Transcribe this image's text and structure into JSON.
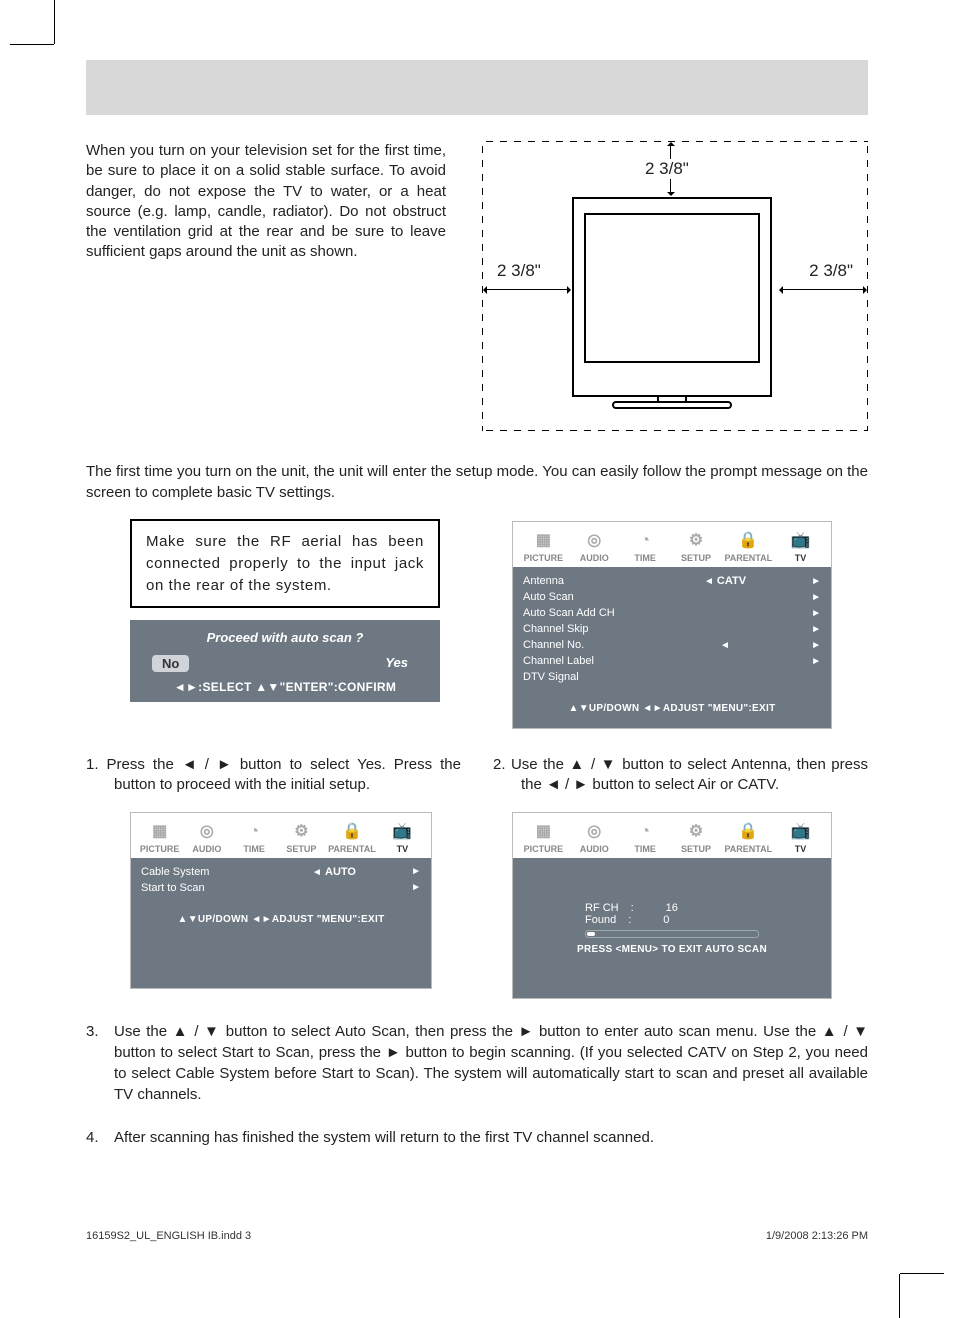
{
  "intro": "When you turn on your television set for the first time, be sure to place it on a solid stable surface. To avoid danger, do not expose the TV to water, or a heat source (e.g. lamp, candle, radiator). Do not obstruct the ventilation grid at the rear and be sure to leave sufficient gaps around the unit as shown.",
  "dims": {
    "top": "2  3/8\"",
    "left": "2  3/8\"",
    "right": "2  3/8\""
  },
  "setup_intro": "The first time you turn on the unit, the unit will enter the setup mode. You can easily follow the prompt message on the screen to complete basic TV settings.",
  "aerial_box": "Make sure the RF aerial has been connected properly to the                      input jack on the rear of the system.",
  "autoscan": {
    "question": "Proceed with auto scan ?",
    "no": "No",
    "yes": "Yes",
    "hint": "◄►:SELECT   ▲▼\"ENTER\":CONFIRM"
  },
  "osd_tabs": [
    "PICTURE",
    "AUDIO",
    "TIME",
    "SETUP",
    "PARENTAL",
    "TV"
  ],
  "osd_icons": [
    "▦",
    "◎",
    "◔",
    "⚙",
    "🔒",
    "📺"
  ],
  "osd1": {
    "rows": [
      {
        "label": "Antenna",
        "left": "◄",
        "value": "CATV",
        "right": "►"
      },
      {
        "label": "Auto Scan",
        "left": "",
        "value": "",
        "right": "►"
      },
      {
        "label": "Auto Scan Add CH",
        "left": "",
        "value": "",
        "right": "►"
      },
      {
        "label": "Channel Skip",
        "left": "",
        "value": "",
        "right": "►"
      },
      {
        "label": "Channel No.",
        "left": "◄",
        "value": "",
        "right": "►"
      },
      {
        "label": "Channel Label",
        "left": "",
        "value": "",
        "right": "►"
      },
      {
        "label": "DTV Signal",
        "left": "",
        "value": "",
        "right": ""
      }
    ],
    "foot": "▲▼UP/DOWN  ◄►ADJUST  \"MENU\":EXIT"
  },
  "step1": "1.  Press the ◄ / ► button to select Yes. Press the        button to proceed with the initial setup.",
  "step2": "2.  Use the ▲ / ▼ button to select Antenna, then press the ◄ / ► button to select Air or CATV.",
  "osd2": {
    "rows": [
      {
        "label": "Cable System",
        "left": "◄",
        "value": "AUTO",
        "right": "►"
      },
      {
        "label": "Start to Scan",
        "left": "",
        "value": "",
        "right": "►"
      }
    ],
    "foot": "▲▼UP/DOWN  ◄►ADJUST  \"MENU\":EXIT"
  },
  "osd3": {
    "rfch_label": "RF CH",
    "rfch_val": "16",
    "found_label": "Found",
    "found_val": "0",
    "foot": "PRESS <MENU> TO EXIT AUTO SCAN"
  },
  "step3": "Use the ▲ / ▼ button to select Auto Scan, then press the ► button to enter auto scan menu. Use the ▲ / ▼ button to select Start to Scan, press the ► button to begin scanning. (If you selected CATV on Step 2, you need to select Cable System before Start to Scan). The system will automatically start to scan and preset all available TV channels.",
  "step3_num": "3.",
  "step4": "After scanning has finished the system will return to the first TV channel scanned.",
  "step4_num": "4.",
  "footer": {
    "left": "16159S2_UL_ENGLISH IB.indd   3",
    "right": "1/9/2008   2:13:26 PM"
  }
}
